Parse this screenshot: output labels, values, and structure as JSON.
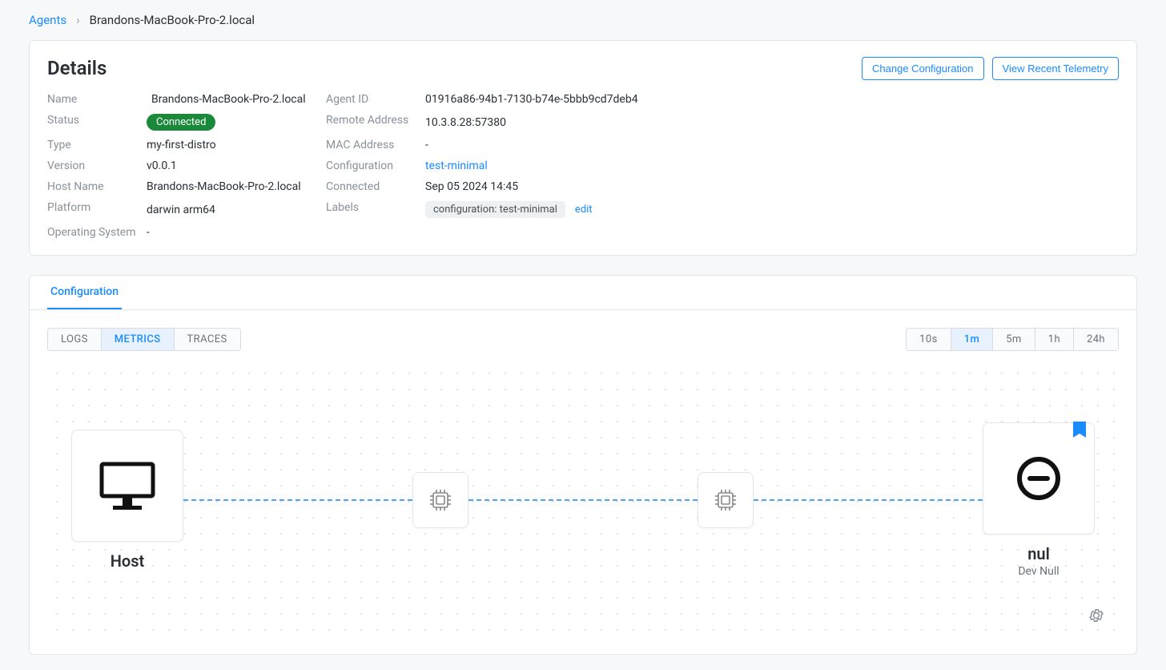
{
  "breadcrumb": {
    "root": "Agents",
    "current": "Brandons-MacBook-Pro-2.local"
  },
  "details": {
    "title": "Details",
    "actions": {
      "change_config": "Change Configuration",
      "view_telemetry": "View Recent Telemetry"
    },
    "left": [
      {
        "label": "Name",
        "value": "Brandons-MacBook-Pro-2.local",
        "kind": "name"
      },
      {
        "label": "Status",
        "value": "Connected",
        "kind": "status"
      },
      {
        "label": "Type",
        "value": "my-first-distro"
      },
      {
        "label": "Version",
        "value": "v0.0.1"
      },
      {
        "label": "Host Name",
        "value": "Brandons-MacBook-Pro-2.local"
      },
      {
        "label": "Platform",
        "value": "darwin arm64"
      },
      {
        "label": "Operating System",
        "value": "-"
      }
    ],
    "right": [
      {
        "label": "Agent ID",
        "value": "01916a86-94b1-7130-b74e-5bbb9cd7deb4"
      },
      {
        "label": "Remote Address",
        "value": "10.3.8.28:57380"
      },
      {
        "label": "MAC Address",
        "value": "-"
      },
      {
        "label": "Configuration",
        "value": "test-minimal",
        "kind": "link"
      },
      {
        "label": "Connected",
        "value": "Sep 05 2024 14:45"
      },
      {
        "label": "Labels",
        "value": "configuration: test-minimal",
        "kind": "chip",
        "edit": "edit"
      }
    ]
  },
  "config_panel": {
    "tabs": [
      "Configuration"
    ],
    "active_tab": 0,
    "data_types": [
      "LOGS",
      "METRICS",
      "TRACES"
    ],
    "active_type": 1,
    "time_ranges": [
      "10s",
      "1m",
      "5m",
      "1h",
      "24h"
    ],
    "active_range": 1,
    "source": {
      "title": "Host"
    },
    "dest": {
      "title": "nul",
      "subtitle": "Dev Null"
    }
  }
}
